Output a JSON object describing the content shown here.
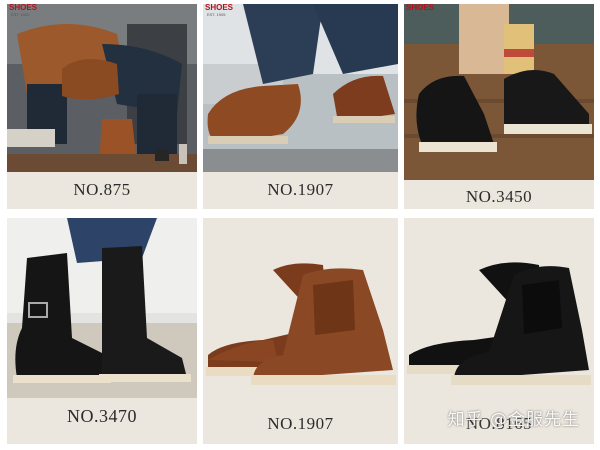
{
  "products": [
    {
      "model": "NO.875",
      "scene": "man lacing boot"
    },
    {
      "model": "NO.1907",
      "scene": "boots on street"
    },
    {
      "model": "NO.3450",
      "scene": "black boots on floor"
    },
    {
      "model": "NO.3470",
      "scene": "engineer boots"
    },
    {
      "model": "NO.1907",
      "scene": "pair brown moc toe"
    },
    {
      "model": "NO.8165",
      "scene": "pair black round toe"
    }
  ],
  "brand": {
    "name": "SHOES",
    "est": "EST. 1905"
  },
  "watermark": "知乎 @金服先生",
  "colors": {
    "background": "#ffffff",
    "card": "#ece7de",
    "caption": "#2b2b2b",
    "brand_red": "#b3141c"
  }
}
